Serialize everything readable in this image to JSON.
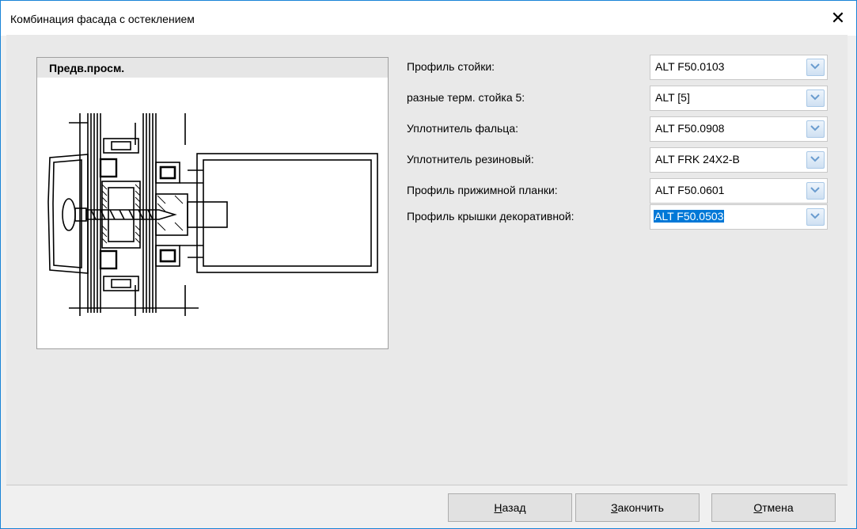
{
  "window": {
    "title": "Комбинация фасада с остеклением",
    "close_glyph": "✕"
  },
  "preview": {
    "title": "Предв.просм."
  },
  "fields": [
    {
      "label": "Профиль стойки:",
      "value": "ALT F50.0103"
    },
    {
      "label": "разные терм. стойка 5:",
      "value": "ALT [5]"
    },
    {
      "label": "Уплотнитель фальца:",
      "value": "ALT F50.0908"
    },
    {
      "label": "Уплотнитель резиновый:",
      "value": "ALT FRK 24X2-B"
    },
    {
      "label": "Профиль прижимной планки:",
      "value": "ALT F50.0601"
    },
    {
      "label": "Профиль крышки декоративной:",
      "value": "ALT F50.0503",
      "selected": true
    }
  ],
  "buttons": {
    "back": {
      "mnemonic": "Н",
      "rest": "азад"
    },
    "finish": {
      "mnemonic": "З",
      "rest": "акончить"
    },
    "cancel": {
      "mnemonic": "О",
      "rest": "тмена"
    }
  },
  "colors": {
    "accent": "#0078d7",
    "window_border": "#1883d7",
    "dropdown_arrow": "#6a9ccf"
  }
}
